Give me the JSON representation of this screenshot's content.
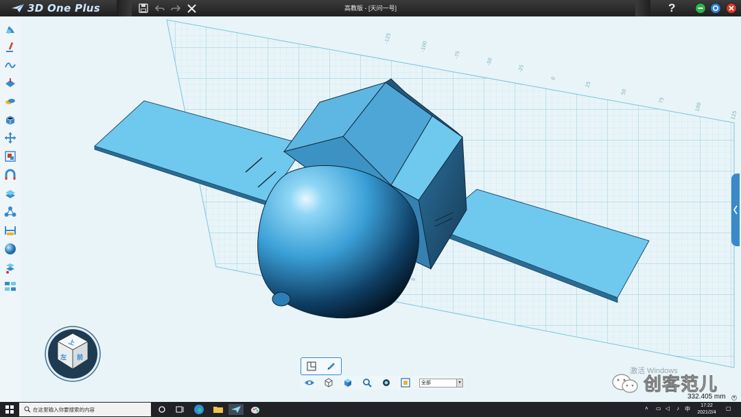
{
  "app": {
    "name": "3D One Plus",
    "window_title": "高教版 - [天问一号]"
  },
  "titlebar": {
    "icons": [
      "save-icon",
      "undo-icon",
      "redo-icon",
      "close-tool-icon"
    ],
    "help": "?",
    "controls": {
      "minimize_color": "#2bb24a",
      "restore_color": "#2f7fd8",
      "close_color": "#d63a2a"
    }
  },
  "left_toolbar": {
    "items": [
      "basic-solid-icon",
      "sketch-icon",
      "curve-icon",
      "feature-icon",
      "combine-icon",
      "special-function-icon",
      "move-icon",
      "material-icon",
      "magnet-icon",
      "distance-icon",
      "assembly-icon",
      "measure-icon",
      "render-icon",
      "community-icon",
      "pattern-icon"
    ]
  },
  "grid": {
    "labels_top": [
      "-125",
      "-100",
      "-75",
      "-50",
      "-25",
      "0",
      "25",
      "50",
      "75",
      "100",
      "125"
    ],
    "label_side": "8"
  },
  "view_cube": {
    "faces": [
      "上",
      "左",
      "前"
    ]
  },
  "bottom_tools": {
    "view_modes": [
      "view-standard-icon",
      "view-edit-icon"
    ],
    "icons": [
      "eye-icon",
      "wireframe-cube-icon",
      "shaded-cube-icon",
      "zoom-icon",
      "fit-view-icon",
      "render-mode-icon"
    ],
    "filter_value": "全部"
  },
  "status": {
    "measurement": "332.405 mm",
    "watermark": "激活 Windows",
    "brand": "创客范儿"
  },
  "colors": {
    "accent": "#3a89c9",
    "model": "#6fc9ee",
    "grid_line": "#9ed3e6"
  },
  "taskbar": {
    "search_placeholder": "在这里输入你要搜索的内容",
    "time": "17:22",
    "date": "2021/2/4",
    "input_method": "中"
  }
}
